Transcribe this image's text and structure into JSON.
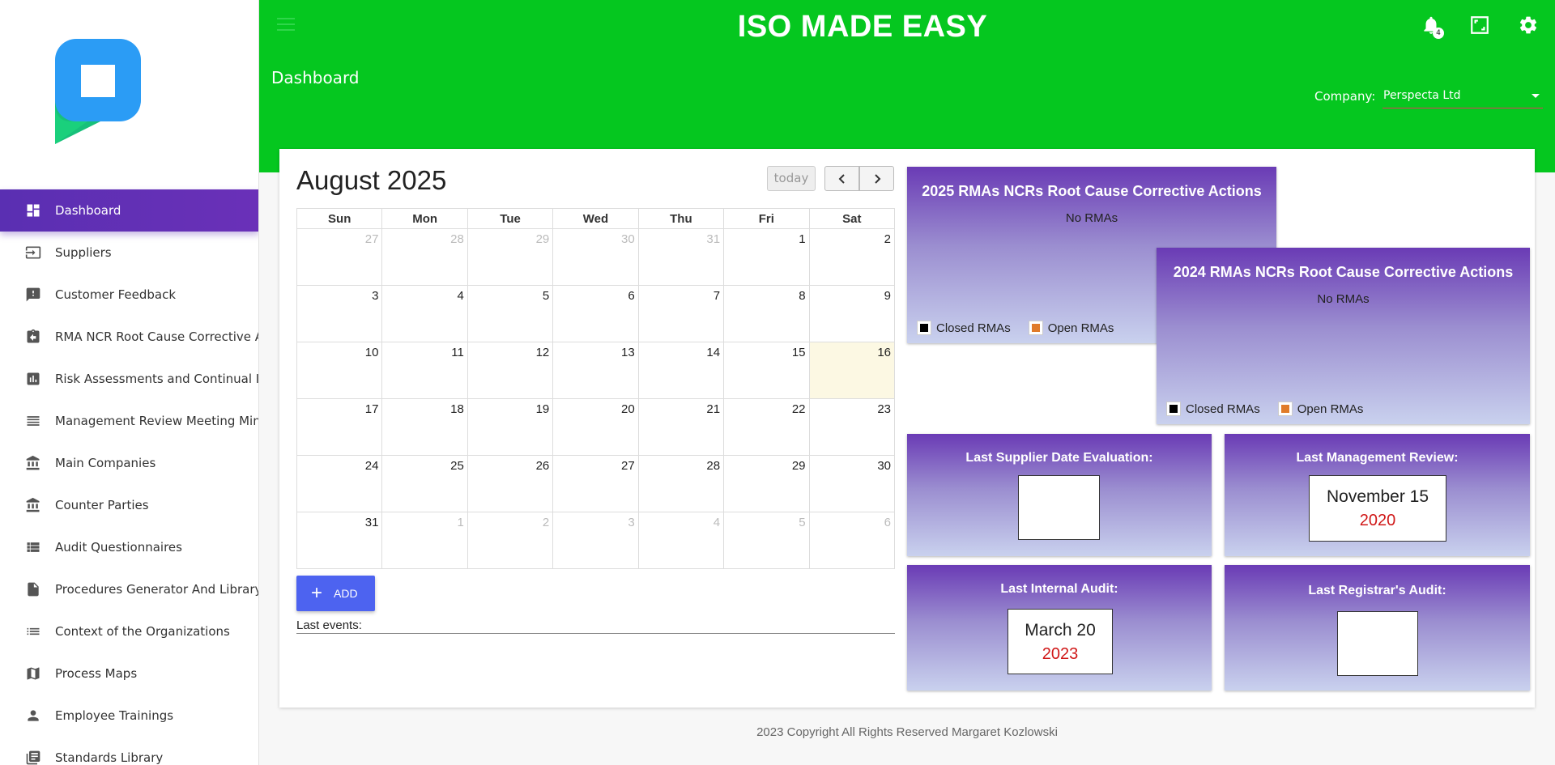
{
  "app": {
    "title": "ISO MADE EASY",
    "page_title": "Dashboard",
    "notifications_count": "4"
  },
  "company": {
    "label": "Company:",
    "value": "Perspecta Ltd"
  },
  "sidebar": {
    "items": [
      {
        "label": "Dashboard",
        "icon": "dashboard-icon",
        "active": true
      },
      {
        "label": "Suppliers",
        "icon": "input-icon"
      },
      {
        "label": "Customer Feedback",
        "icon": "feedback-icon"
      },
      {
        "label": "RMA NCR Root Cause Corrective Actions",
        "icon": "assignment-return-icon"
      },
      {
        "label": "Risk Assessments and Continual Improvement",
        "icon": "bar-chart-icon"
      },
      {
        "label": "Management Review Meeting Minutes",
        "icon": "list-icon"
      },
      {
        "label": "Main Companies",
        "icon": "bank-icon"
      },
      {
        "label": "Counter Parties",
        "icon": "bank-icon"
      },
      {
        "label": "Audit Questionnaires",
        "icon": "view-list-icon"
      },
      {
        "label": "Procedures Generator And Library",
        "icon": "file-icon"
      },
      {
        "label": "Context of the Organizations",
        "icon": "format-list-icon"
      },
      {
        "label": "Process Maps",
        "icon": "map-icon"
      },
      {
        "label": "Employee Trainings",
        "icon": "person-icon"
      },
      {
        "label": "Standards Library",
        "icon": "library-icon"
      }
    ]
  },
  "calendar": {
    "title": "August 2025",
    "today_label": "today",
    "prev_label": "‹",
    "next_label": "›",
    "weekdays": [
      "Sun",
      "Mon",
      "Tue",
      "Wed",
      "Thu",
      "Fri",
      "Sat"
    ],
    "weeks": [
      [
        {
          "d": "27",
          "m": true
        },
        {
          "d": "28",
          "m": true
        },
        {
          "d": "29",
          "m": true
        },
        {
          "d": "30",
          "m": true
        },
        {
          "d": "31",
          "m": true
        },
        {
          "d": "1"
        },
        {
          "d": "2"
        }
      ],
      [
        {
          "d": "3"
        },
        {
          "d": "4"
        },
        {
          "d": "5"
        },
        {
          "d": "6"
        },
        {
          "d": "7"
        },
        {
          "d": "8"
        },
        {
          "d": "9"
        }
      ],
      [
        {
          "d": "10"
        },
        {
          "d": "11"
        },
        {
          "d": "12"
        },
        {
          "d": "13"
        },
        {
          "d": "14"
        },
        {
          "d": "15"
        },
        {
          "d": "16",
          "t": true
        }
      ],
      [
        {
          "d": "17"
        },
        {
          "d": "18"
        },
        {
          "d": "19"
        },
        {
          "d": "20"
        },
        {
          "d": "21"
        },
        {
          "d": "22"
        },
        {
          "d": "23"
        }
      ],
      [
        {
          "d": "24"
        },
        {
          "d": "25"
        },
        {
          "d": "26"
        },
        {
          "d": "27"
        },
        {
          "d": "28"
        },
        {
          "d": "29"
        },
        {
          "d": "30"
        }
      ],
      [
        {
          "d": "31"
        },
        {
          "d": "1",
          "m": true
        },
        {
          "d": "2",
          "m": true
        },
        {
          "d": "3",
          "m": true
        },
        {
          "d": "4",
          "m": true
        },
        {
          "d": "5",
          "m": true
        },
        {
          "d": "6",
          "m": true
        }
      ]
    ],
    "add_label": "ADD",
    "last_events_label": "Last events:"
  },
  "rma_2025": {
    "title": "2025 RMAs NCRs Root Cause Corrective Actions",
    "empty": "No RMAs",
    "legend_closed": "Closed RMAs",
    "legend_open": "Open RMAs"
  },
  "rma_2024": {
    "title": "2024 RMAs NCRs Root Cause Corrective Actions",
    "empty": "No RMAs",
    "legend_closed": "Closed RMAs",
    "legend_open": "Open RMAs"
  },
  "colors": {
    "closed": "#000000",
    "open": "#e07b2a",
    "header": "#05c71f",
    "accent": "#5a2fb2"
  },
  "last_supplier": {
    "title": "Last Supplier Date Evaluation:"
  },
  "last_management": {
    "title": "Last Management Review:",
    "month_day": "November 15",
    "year": "2020"
  },
  "last_internal": {
    "title": "Last Internal Audit:",
    "month_day": "March 20",
    "year": "2023"
  },
  "last_registrar": {
    "title": "Last Registrar's Audit:"
  },
  "footer": {
    "text": "2023 Copyright All Rights Reserved Margaret Kozlowski"
  }
}
